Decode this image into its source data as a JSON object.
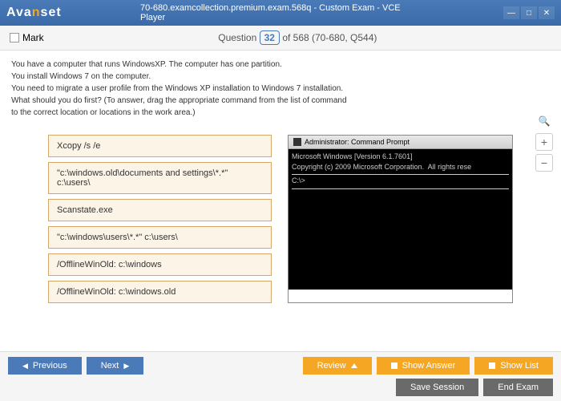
{
  "titlebar": {
    "logo_pre": "Ava",
    "logo_mid": "n",
    "logo_post": "set",
    "title": "70-680.examcollection.premium.exam.568q - Custom Exam - VCE Player"
  },
  "header": {
    "mark_label": "Mark",
    "q_word": "Question",
    "q_num": "32",
    "q_total": " of 568 (70-680, Q544)"
  },
  "question": {
    "line1": "You have a computer that runs WindowsXP. The computer has one partition.",
    "line2": "You install Windows 7 on the computer.",
    "line3": "You need to migrate a user profile from the Windows XP installation to Windows 7 installation.",
    "line4": "What should you do first? (To answer, drag the appropriate command from the list of command",
    "line5": "to the correct location or locations in the work area.)"
  },
  "options": {
    "o1": "Xcopy /s /e",
    "o2": "\"c:\\windows.old\\documents and settings\\*.*\" c:\\users\\",
    "o3": "Scanstate.exe",
    "o4": "\"c:\\windows\\users\\*.*\" c:\\users\\",
    "o5": "/OfflineWinOld: c:\\windows",
    "o6": "/OfflineWinOld: c:\\windows.old"
  },
  "cmd": {
    "title": "Administrator: Command Prompt",
    "line1": "Microsoft Windows [Version 6.1.7601]",
    "line2": "Copyright (c) 2009 Microsoft Corporation.  All rights rese",
    "prompt": "C:\\>"
  },
  "buttons": {
    "prev": "Previous",
    "next": "Next",
    "review": "Review",
    "show_answer": "Show Answer",
    "show_list": "Show List",
    "save_session": "Save Session",
    "end_exam": "End Exam"
  },
  "zoom": {
    "plus": "+",
    "minus": "−"
  }
}
